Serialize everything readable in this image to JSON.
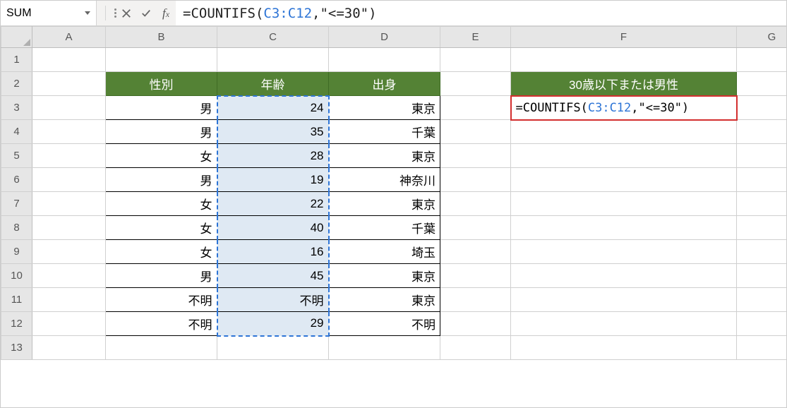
{
  "name_box": "SUM",
  "formula_prefix": "=COUNTIFS(",
  "formula_ref": "C3:C12",
  "formula_suffix": ",\"<=30\")",
  "columns": [
    "A",
    "B",
    "C",
    "D",
    "E",
    "F",
    "G"
  ],
  "row_numbers": [
    "1",
    "2",
    "3",
    "4",
    "5",
    "6",
    "7",
    "8",
    "9",
    "10",
    "11",
    "12",
    "13"
  ],
  "headers": {
    "B": "性別",
    "C": "年齢",
    "D": "出身",
    "F": "30歳以下または男性"
  },
  "rows": [
    {
      "B": "男",
      "C": "24",
      "D": "東京"
    },
    {
      "B": "男",
      "C": "35",
      "D": "千葉"
    },
    {
      "B": "女",
      "C": "28",
      "D": "東京"
    },
    {
      "B": "男",
      "C": "19",
      "D": "神奈川"
    },
    {
      "B": "女",
      "C": "22",
      "D": "東京"
    },
    {
      "B": "女",
      "C": "40",
      "D": "千葉"
    },
    {
      "B": "女",
      "C": "16",
      "D": "埼玉"
    },
    {
      "B": "男",
      "C": "45",
      "D": "東京"
    },
    {
      "B": "不明",
      "C": "不明",
      "D": "東京"
    },
    {
      "B": "不明",
      "C": "29",
      "D": "不明"
    }
  ],
  "cell_formula_prefix": "=COUNTIFS(",
  "cell_formula_ref": "C3:C12",
  "cell_formula_suffix": ",\"<=30\")"
}
